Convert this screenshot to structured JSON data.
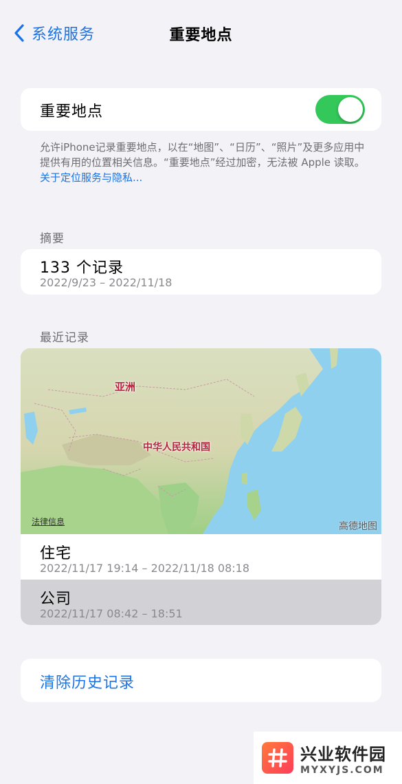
{
  "nav": {
    "back_label": "系统服务",
    "title": "重要地点"
  },
  "toggle": {
    "label": "重要地点",
    "enabled": true,
    "on_color": "#34c759"
  },
  "footnote": {
    "text": "允许iPhone记录重要地点，以在“地图”、“日历”、“照片”及更多应用中提供有用的位置相关信息。“重要地点”经过加密，无法被 Apple 读取。",
    "link": "关于定位服务与隐私..."
  },
  "summary": {
    "header": "摘要",
    "count": "133 个记录",
    "range": "2022/9/23 – 2022/11/18"
  },
  "recent": {
    "header": "最近记录",
    "map": {
      "labels": [
        "亚洲",
        "中华人民共和国"
      ],
      "legal": "法律信息",
      "brand": "高德地图"
    },
    "locations": [
      {
        "name": "住宅",
        "time": "2022/11/17 19:14 – 2022/11/18 08:18"
      },
      {
        "name": "公司",
        "time": "2022/11/17 08:42 – 18:51"
      }
    ]
  },
  "actions": {
    "clear_history": "清除历史记录"
  },
  "watermark": {
    "title": "兴业软件园",
    "subtitle": "MYXYJS.COM"
  },
  "colors": {
    "accent": "#1a73e8",
    "background": "#f2f2f7",
    "selected_row": "#d1d1d6"
  }
}
